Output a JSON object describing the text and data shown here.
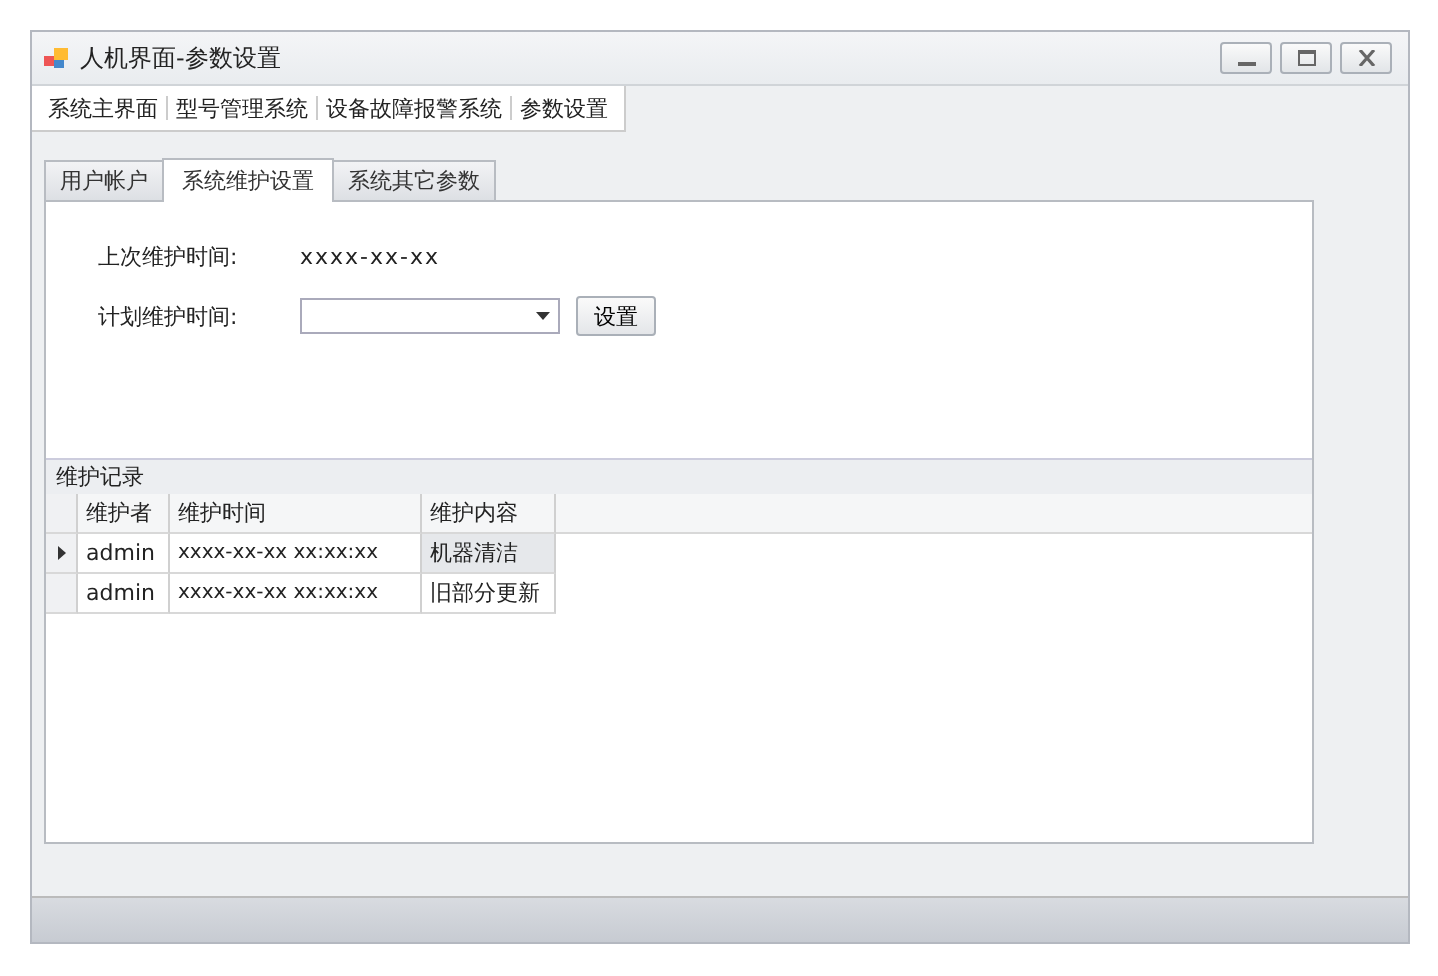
{
  "window": {
    "title": "人机界面-参数设置"
  },
  "menu": [
    {
      "label": "系统主界面"
    },
    {
      "label": "型号管理系统"
    },
    {
      "label": "设备故障报警系统"
    },
    {
      "label": "参数设置"
    }
  ],
  "tabs": [
    {
      "label": "用户帐户",
      "selected": false
    },
    {
      "label": "系统维护设置",
      "selected": true
    },
    {
      "label": "系统其它参数",
      "selected": false
    }
  ],
  "form": {
    "last_label": "上次维护时间:",
    "last_value": "xxxx-xx-xx",
    "plan_label": "计划维护时间:",
    "set_button": "设置"
  },
  "records": {
    "title": "维护记录",
    "columns": [
      "维护者",
      "维护时间",
      "维护内容"
    ],
    "rows": [
      {
        "cells": [
          "admin",
          "xxxx-xx-xx xx:xx:xx",
          "机器清洁"
        ],
        "selected": true
      },
      {
        "cells": [
          "admin",
          "xxxx-xx-xx xx:xx:xx",
          "旧部分更新"
        ],
        "selected": false
      }
    ]
  }
}
